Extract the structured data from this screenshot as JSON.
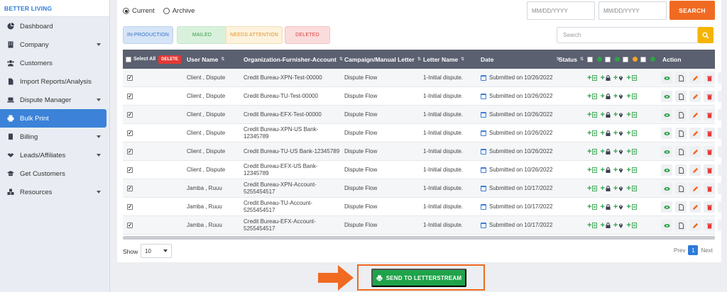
{
  "brand": "BETTER LIVING",
  "sidebar": {
    "items": [
      {
        "label": "Dashboard",
        "icon": "pie-chart-icon",
        "caret": false
      },
      {
        "label": "Company",
        "icon": "building-icon",
        "caret": true
      },
      {
        "label": "Customers",
        "icon": "users-icon",
        "caret": false
      },
      {
        "label": "Import Reports/Analysis",
        "icon": "file-import-icon",
        "caret": false
      },
      {
        "label": "Dispute Manager",
        "icon": "laptop-icon",
        "caret": true
      },
      {
        "label": "Bulk Print",
        "icon": "printer-icon",
        "caret": false,
        "active": true
      },
      {
        "label": "Billing",
        "icon": "invoice-icon",
        "caret": true
      },
      {
        "label": "Leads/Affiliates",
        "icon": "handshake-icon",
        "caret": true
      },
      {
        "label": "Get Customers",
        "icon": "graduation-cap-icon",
        "caret": false
      },
      {
        "label": "Resources",
        "icon": "boxes-icon",
        "caret": true
      }
    ]
  },
  "filters": {
    "radio_current": "Current",
    "radio_archive": "Archive",
    "date_from_placeholder": "MM/DD/YYYY",
    "date_to_placeholder": "MM/DD/YYYY",
    "search_button": "SEARCH",
    "chips": {
      "in_production": "IN-PRODUCTION",
      "mailed": "MAILED",
      "needs_attention": "NEEDS ATTENTION",
      "deleted": "DELETED"
    },
    "search_placeholder": "Search"
  },
  "table": {
    "headers": {
      "select_all": "Select All",
      "delete": "DELETE",
      "user_name": "User Name",
      "account": "Organization-Furnisher-Account",
      "campaign": "Campaign/Manual Letter",
      "letter_name": "Letter Name",
      "date": "Date",
      "status": "Status",
      "action": "Action"
    },
    "rows": [
      {
        "user": "Client , Dispute",
        "account": "Credit Bureau-XPN-Test-00000",
        "campaign": "Dispute Flow",
        "letter": "1-Initial dispute.",
        "date": "Submitted on 10/26/2022"
      },
      {
        "user": "Client , Dispute",
        "account": "Credit Bureau-TU-Test-00000",
        "campaign": "Dispute Flow",
        "letter": "1-Initial dispute.",
        "date": "Submitted on 10/26/2022"
      },
      {
        "user": "Client , Dispute",
        "account": "Credit Bureau-EFX-Test-00000",
        "campaign": "Dispute Flow",
        "letter": "1-Initial dispute.",
        "date": "Submitted on 10/26/2022"
      },
      {
        "user": "Client , Dispute",
        "account": "Credit Bureau-XPN-US Bank-\n12345789",
        "campaign": "Dispute Flow",
        "letter": "1-Initial dispute.",
        "date": "Submitted on 10/26/2022"
      },
      {
        "user": "Client , Dispute",
        "account": "Credit Bureau-TU-US Bank-12345789",
        "campaign": "Dispute Flow",
        "letter": "1-Initial dispute.",
        "date": "Submitted on 10/26/2022"
      },
      {
        "user": "Client , Dispute",
        "account": "Credit Bureau-EFX-US Bank-12345789",
        "campaign": "Dispute Flow",
        "letter": "1-Initial dispute.",
        "date": "Submitted on 10/26/2022"
      },
      {
        "user": "Jamba , Ruuu",
        "account": "Credit Bureau-XPN-Account-\n5255454517",
        "campaign": "Dispute Flow",
        "letter": "1-Initial dispute.",
        "date": "Submitted on 10/17/2022"
      },
      {
        "user": "Jamba , Ruuu",
        "account": "Credit Bureau-TU-Account-\n5255454517",
        "campaign": "Dispute Flow",
        "letter": "1-Initial dispute.",
        "date": "Submitted on 10/17/2022"
      },
      {
        "user": "Jamba , Ruuu",
        "account": "Credit Bureau-EFX-Account-\n5255454517",
        "campaign": "Dispute Flow",
        "letter": "1-Initial dispute.",
        "date": "Submitted on 10/17/2022"
      }
    ]
  },
  "footer": {
    "show_label": "Show",
    "show_value": "10",
    "prev": "Prev",
    "page": "1",
    "next": "Next",
    "send_button": "SEND TO LETTERSTREAM"
  },
  "colors": {
    "accent_orange": "#f06a22",
    "active_blue": "#3b82d8",
    "send_green": "#1fa34a",
    "header_dark": "#5a6070"
  }
}
